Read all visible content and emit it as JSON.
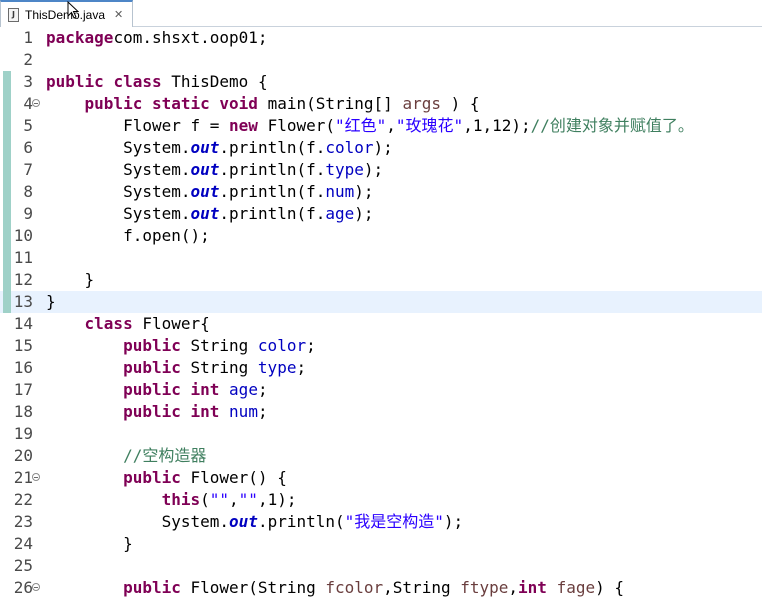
{
  "tab": {
    "filename": "ThisDemo.java",
    "close_glyph": "✕",
    "file_icon_letter": "J"
  },
  "editor": {
    "lines": [
      {
        "n": "1",
        "tokens": [
          [
            "kw",
            "package"
          ],
          [
            "",
            "com.shsxt.oop01;"
          ]
        ]
      },
      {
        "n": "2",
        "tokens": []
      },
      {
        "n": "3",
        "tokens": [
          [
            "kw",
            "public"
          ],
          [
            "",
            " "
          ],
          [
            "kw",
            "class"
          ],
          [
            "",
            " ThisDemo {"
          ]
        ]
      },
      {
        "n": "4",
        "fold": true,
        "tokens": [
          [
            "",
            "    "
          ],
          [
            "kw",
            "public"
          ],
          [
            "",
            " "
          ],
          [
            "kw",
            "static"
          ],
          [
            "",
            " "
          ],
          [
            "kw",
            "void"
          ],
          [
            "",
            " main(String[] "
          ],
          [
            "prm",
            "args"
          ],
          [
            "",
            " ) {"
          ]
        ]
      },
      {
        "n": "5",
        "tokens": [
          [
            "",
            "        Flower f = "
          ],
          [
            "kw",
            "new"
          ],
          [
            "",
            " Flower("
          ],
          [
            "str",
            "\"红色\""
          ],
          [
            "",
            ","
          ],
          [
            "str",
            "\"玫瑰花\""
          ],
          [
            "",
            ",1,12);"
          ],
          [
            "cm",
            "//创建对象并赋值了。"
          ]
        ]
      },
      {
        "n": "6",
        "tokens": [
          [
            "",
            "        System."
          ],
          [
            "stat",
            "out"
          ],
          [
            "",
            ".println(f."
          ],
          [
            "fld",
            "color"
          ],
          [
            "",
            ");"
          ]
        ]
      },
      {
        "n": "7",
        "tokens": [
          [
            "",
            "        System."
          ],
          [
            "stat",
            "out"
          ],
          [
            "",
            ".println(f."
          ],
          [
            "fld",
            "type"
          ],
          [
            "",
            ");"
          ]
        ]
      },
      {
        "n": "8",
        "tokens": [
          [
            "",
            "        System."
          ],
          [
            "stat",
            "out"
          ],
          [
            "",
            ".println(f."
          ],
          [
            "fld",
            "num"
          ],
          [
            "",
            ");"
          ]
        ]
      },
      {
        "n": "9",
        "tokens": [
          [
            "",
            "        System."
          ],
          [
            "stat",
            "out"
          ],
          [
            "",
            ".println(f."
          ],
          [
            "fld",
            "age"
          ],
          [
            "",
            ");"
          ]
        ]
      },
      {
        "n": "10",
        "tokens": [
          [
            "",
            "        f.open();"
          ]
        ]
      },
      {
        "n": "11",
        "tokens": []
      },
      {
        "n": "12",
        "tokens": [
          [
            "",
            "    }"
          ]
        ]
      },
      {
        "n": "13",
        "tokens": [
          [
            "",
            "}"
          ]
        ],
        "highlight": true
      },
      {
        "n": "14",
        "tokens": [
          [
            "",
            "    "
          ],
          [
            "kw",
            "class"
          ],
          [
            "",
            " Flower{"
          ]
        ]
      },
      {
        "n": "15",
        "tokens": [
          [
            "",
            "        "
          ],
          [
            "kw",
            "public"
          ],
          [
            "",
            " String "
          ],
          [
            "fld",
            "color"
          ],
          [
            "",
            ";"
          ]
        ]
      },
      {
        "n": "16",
        "tokens": [
          [
            "",
            "        "
          ],
          [
            "kw",
            "public"
          ],
          [
            "",
            " String "
          ],
          [
            "fld",
            "type"
          ],
          [
            "",
            ";"
          ]
        ]
      },
      {
        "n": "17",
        "tokens": [
          [
            "",
            "        "
          ],
          [
            "kw",
            "public"
          ],
          [
            "",
            " "
          ],
          [
            "kw",
            "int"
          ],
          [
            "",
            " "
          ],
          [
            "fld",
            "age"
          ],
          [
            "",
            ";"
          ]
        ]
      },
      {
        "n": "18",
        "tokens": [
          [
            "",
            "        "
          ],
          [
            "kw",
            "public"
          ],
          [
            "",
            " "
          ],
          [
            "kw",
            "int"
          ],
          [
            "",
            " "
          ],
          [
            "fld",
            "num"
          ],
          [
            "",
            ";"
          ]
        ]
      },
      {
        "n": "19",
        "tokens": []
      },
      {
        "n": "20",
        "tokens": [
          [
            "",
            "        "
          ],
          [
            "cm",
            "//空构造器"
          ]
        ]
      },
      {
        "n": "21",
        "fold": true,
        "tokens": [
          [
            "",
            "        "
          ],
          [
            "kw",
            "public"
          ],
          [
            "",
            " Flower() {"
          ]
        ]
      },
      {
        "n": "22",
        "tokens": [
          [
            "",
            "            "
          ],
          [
            "kw",
            "this"
          ],
          [
            "",
            "("
          ],
          [
            "str",
            "\"\""
          ],
          [
            "",
            ","
          ],
          [
            "str",
            "\"\""
          ],
          [
            "",
            ",1);"
          ]
        ]
      },
      {
        "n": "23",
        "tokens": [
          [
            "",
            "            System."
          ],
          [
            "stat",
            "out"
          ],
          [
            "",
            ".println("
          ],
          [
            "str",
            "\"我是空构造\""
          ],
          [
            "",
            ");"
          ]
        ]
      },
      {
        "n": "24",
        "tokens": [
          [
            "",
            "        }"
          ]
        ]
      },
      {
        "n": "25",
        "tokens": []
      },
      {
        "n": "26",
        "fold": true,
        "tokens": [
          [
            "",
            "        "
          ],
          [
            "kw",
            "public"
          ],
          [
            "",
            " Flower(String "
          ],
          [
            "prm",
            "fcolor"
          ],
          [
            "",
            ",String "
          ],
          [
            "prm",
            "ftype"
          ],
          [
            "",
            ","
          ],
          [
            "kw",
            "int"
          ],
          [
            "",
            " "
          ],
          [
            "prm",
            "fage"
          ],
          [
            "",
            ") {"
          ]
        ]
      }
    ]
  }
}
